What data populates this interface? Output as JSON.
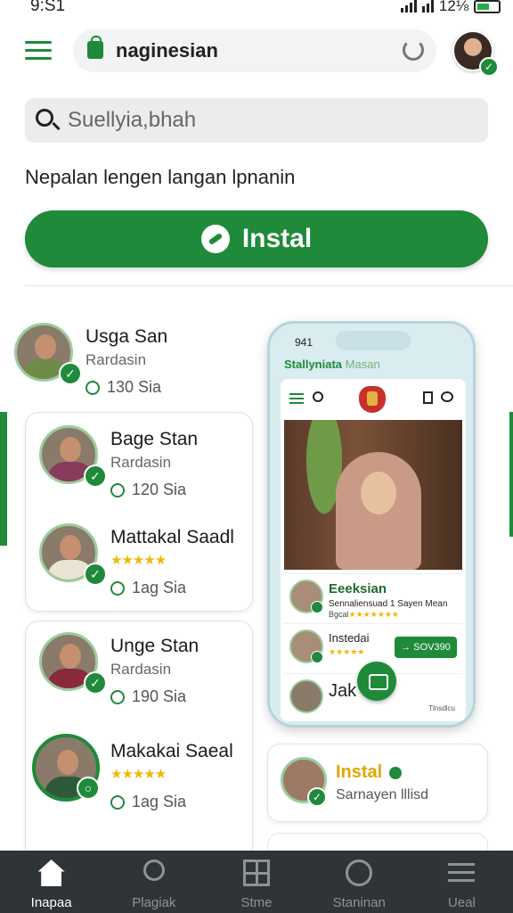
{
  "status_bar": {
    "time": "9:S1",
    "battery": "12⅛"
  },
  "header": {
    "url": "naginesian"
  },
  "search": {
    "placeholder": "Suellyia,bhah"
  },
  "subtitle": "Nepalan lengen langan lpnanin",
  "install_button": {
    "label": "Instal"
  },
  "list": [
    {
      "name": "Usga San",
      "role": "Rardasin",
      "meta": "130 Sia"
    },
    {
      "name": "Bage Stan",
      "role": "Rardasin",
      "meta": "120 Sia"
    },
    {
      "name": "Mattakal Saadl",
      "rating": "★★★★★",
      "meta": "1ag Sia"
    },
    {
      "name": "Unge Stan",
      "role": "Rardasin",
      "meta": "190 Sia"
    },
    {
      "name": "Makakai Saeal",
      "rating": "★★★★★",
      "meta": "1ag Sia"
    }
  ],
  "phone": {
    "time": "941",
    "brand": "Stallyniata",
    "brand_suffix": "Masan",
    "row1": {
      "name": "Eeeksian",
      "desc": "Sennaliensuad 1 Sayen Mean",
      "rating_prefix": "Bgcal",
      "rating": "★★★★★★★"
    },
    "row2": {
      "name": "Instedai",
      "rating": "★★★★★",
      "button": "→ SOV390"
    },
    "nav": {
      "name": "Jak",
      "label": "Tlnsdlcu"
    }
  },
  "right_card": {
    "title": "Instal",
    "subtitle": "Sarnayen lllisd"
  },
  "bottom_nav": [
    {
      "label": "Inapaa",
      "icon": "home-icon"
    },
    {
      "label": "Plagiak",
      "icon": "search-icon"
    },
    {
      "label": "Stme",
      "icon": "grid-icon"
    },
    {
      "label": "Staninan",
      "icon": "clock-icon"
    },
    {
      "label": "Ueal",
      "icon": "menu-icon"
    }
  ],
  "colors": {
    "accent": "#1f8a3a",
    "star": "#f2b705",
    "nav_bg": "#2f3436"
  }
}
